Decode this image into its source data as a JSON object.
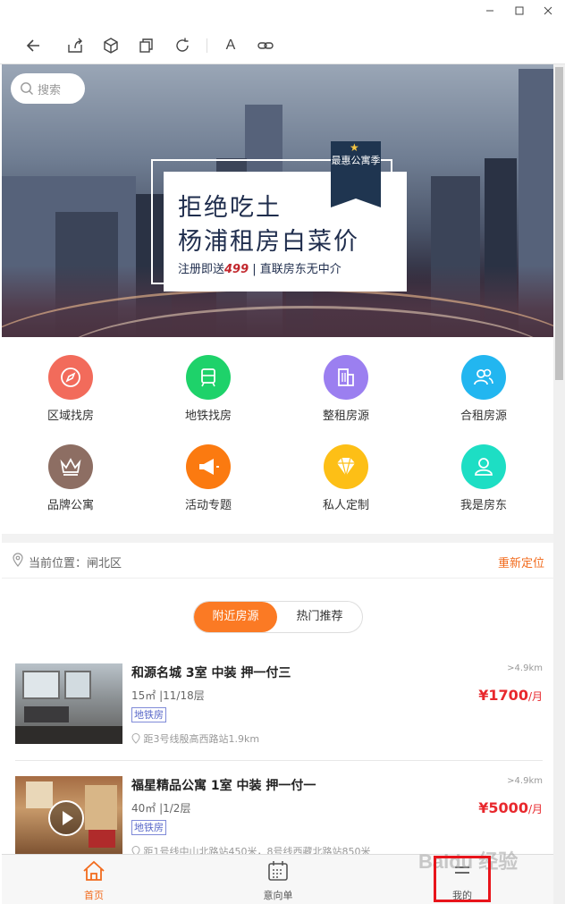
{
  "window": {
    "controls": [
      "minimize",
      "maximize",
      "close"
    ]
  },
  "toolbar": {
    "icons": [
      "back-arrow-icon",
      "share-icon",
      "cube-icon",
      "copy-icon",
      "refresh-icon",
      "font-icon",
      "link-icon"
    ],
    "font_glyph": "A"
  },
  "search": {
    "placeholder": "搜索"
  },
  "banner": {
    "line1": "拒绝吃土",
    "line2": "杨浦租房白菜价",
    "line3_prefix": "注册即送",
    "line3_highlight": "499",
    "line3_suffix": "| 直联房东无中介",
    "badge": "最惠公寓季"
  },
  "categories": [
    {
      "label": "区域找房",
      "icon": "compass-icon",
      "color": "#f26b5b"
    },
    {
      "label": "地铁找房",
      "icon": "subway-icon",
      "color": "#1ed26a"
    },
    {
      "label": "整租房源",
      "icon": "building-icon",
      "color": "#9b7ff0"
    },
    {
      "label": "合租房源",
      "icon": "people-icon",
      "color": "#22b6f0"
    },
    {
      "label": "品牌公寓",
      "icon": "crown-icon",
      "color": "#8d6e63"
    },
    {
      "label": "活动专题",
      "icon": "megaphone-icon",
      "color": "#fb7a10"
    },
    {
      "label": "私人定制",
      "icon": "diamond-icon",
      "color": "#fdbf16"
    },
    {
      "label": "我是房东",
      "icon": "person-icon",
      "color": "#1ddec4"
    }
  ],
  "location": {
    "label": "当前位置：闸北区",
    "relocate": "重新定位"
  },
  "segment": {
    "active": "附近房源",
    "inactive": "热门推荐"
  },
  "listings": [
    {
      "title": "和源名城 3室 中装 押一付三",
      "spec": "15㎡ |11/18层",
      "tag": "地铁房",
      "sub": "距3号线殷高西路站1.9km",
      "distance": ">4.9km",
      "price": "¥1700",
      "unit": "/月"
    },
    {
      "title": "福星精品公寓 1室 中装 押一付一",
      "spec": "40㎡ |1/2层",
      "tag": "地铁房",
      "sub": "距1号线中山北路站450米，8号线西藏北路站850米",
      "distance": ">4.9km",
      "price": "¥5000",
      "unit": "/月"
    }
  ],
  "tabbar": {
    "tabs": [
      {
        "label": "首页",
        "icon": "home-icon",
        "active": true
      },
      {
        "label": "意向单",
        "icon": "calendar-icon",
        "active": false
      },
      {
        "label": "我的",
        "icon": "user-icon",
        "active": false
      }
    ]
  },
  "colors": {
    "accent": "#fb7a24",
    "price": "#e8282d",
    "highlight": "#e8141b"
  }
}
